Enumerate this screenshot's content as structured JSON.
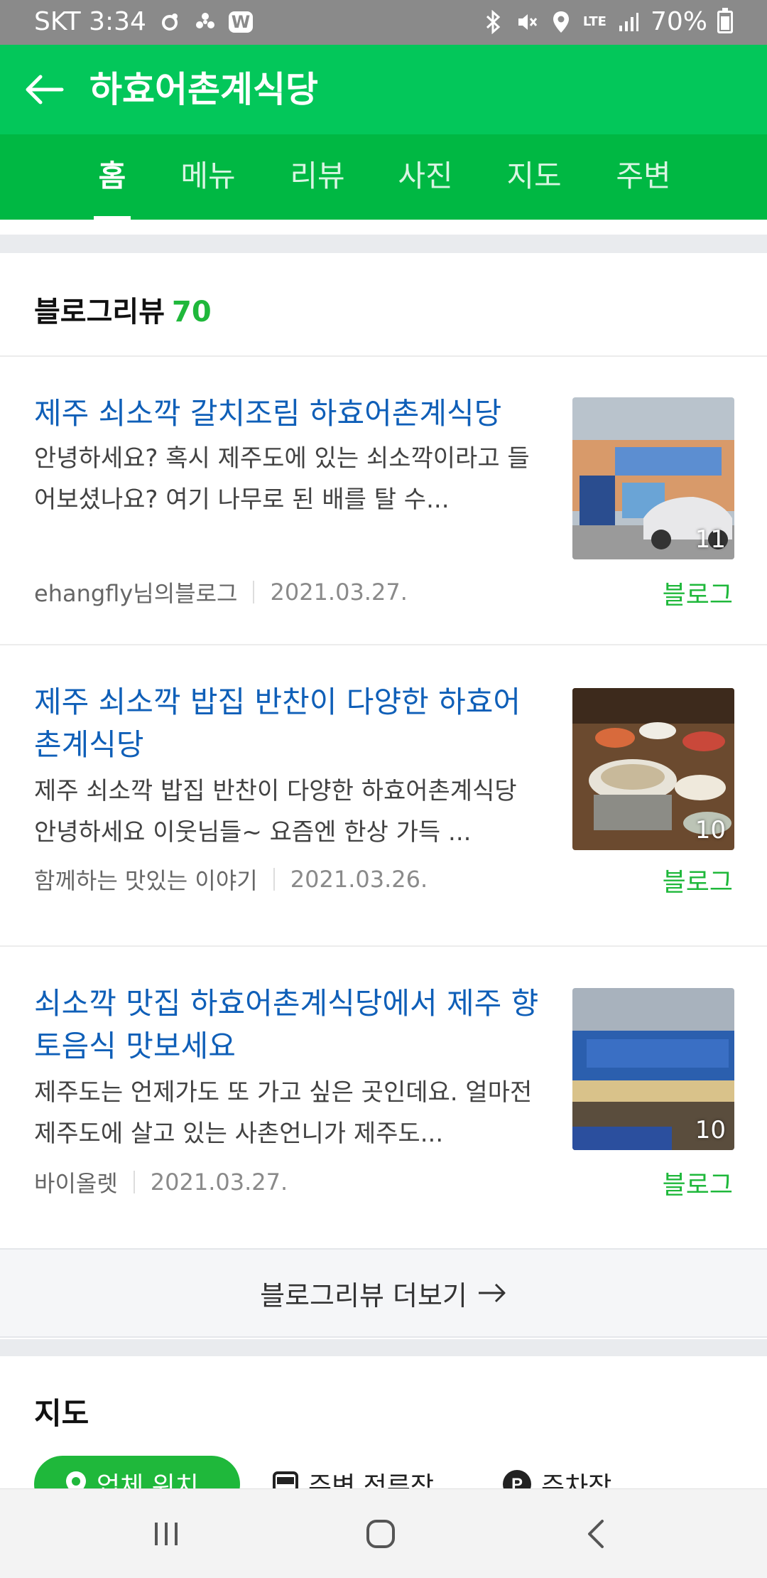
{
  "status_bar": {
    "carrier_time": "SKT 3:34",
    "network": "LTE",
    "battery": "70%"
  },
  "app_bar": {
    "title": "하효어촌계식당"
  },
  "tabs": [
    {
      "label": "홈",
      "active": true
    },
    {
      "label": "메뉴",
      "active": false
    },
    {
      "label": "리뷰",
      "active": false
    },
    {
      "label": "사진",
      "active": false
    },
    {
      "label": "지도",
      "active": false
    },
    {
      "label": "주변",
      "active": false
    }
  ],
  "blog_section": {
    "title": "블로그리뷰",
    "count": "70",
    "posts": [
      {
        "title": "제주 쇠소깍 갈치조림 하효어촌계식당",
        "snippet": "안녕하세요? 혹시 제주도에 있는 쇠소깍이라고 들어보셨나요? 여기 나무로 된 배를 탈 수...",
        "author": "ehangfly님의블로그",
        "date": "2021.03.27.",
        "type": "블로그",
        "photo_count": "11"
      },
      {
        "title": "제주 쇠소깍 밥집 반찬이 다양한 하효어촌계식당",
        "snippet": "제주 쇠소깍 밥집 반찬이 다양한 하효어촌계식당 안녕하세요 이웃님들~ 요즘엔 한상 가득 ...",
        "author": "함께하는 맛있는 이야기",
        "date": "2021.03.26.",
        "type": "블로그",
        "photo_count": "10"
      },
      {
        "title": "쇠소깍 맛집 하효어촌계식당에서 제주 향토음식 맛보세요",
        "snippet": "제주도는 언제가도 또 가고 싶은 곳인데요. 얼마전 제주도에 살고 있는 사촌언니가 제주도...",
        "author": "바이올렛",
        "date": "2021.03.27.",
        "type": "블로그",
        "photo_count": "10"
      }
    ],
    "more_label": "블로그리뷰 더보기"
  },
  "map_section": {
    "title": "지도",
    "chips": [
      {
        "label": "업체 위치",
        "icon": "location-pin-icon"
      },
      {
        "label": "주변 정류장",
        "icon": "bus-icon"
      },
      {
        "label": "주차장",
        "icon": "parking-icon"
      }
    ]
  },
  "colors": {
    "app_bar": "#03c75a",
    "tab_bar": "#00b843",
    "accent_green": "#1fb83b",
    "link_blue": "#0f5fb8"
  }
}
